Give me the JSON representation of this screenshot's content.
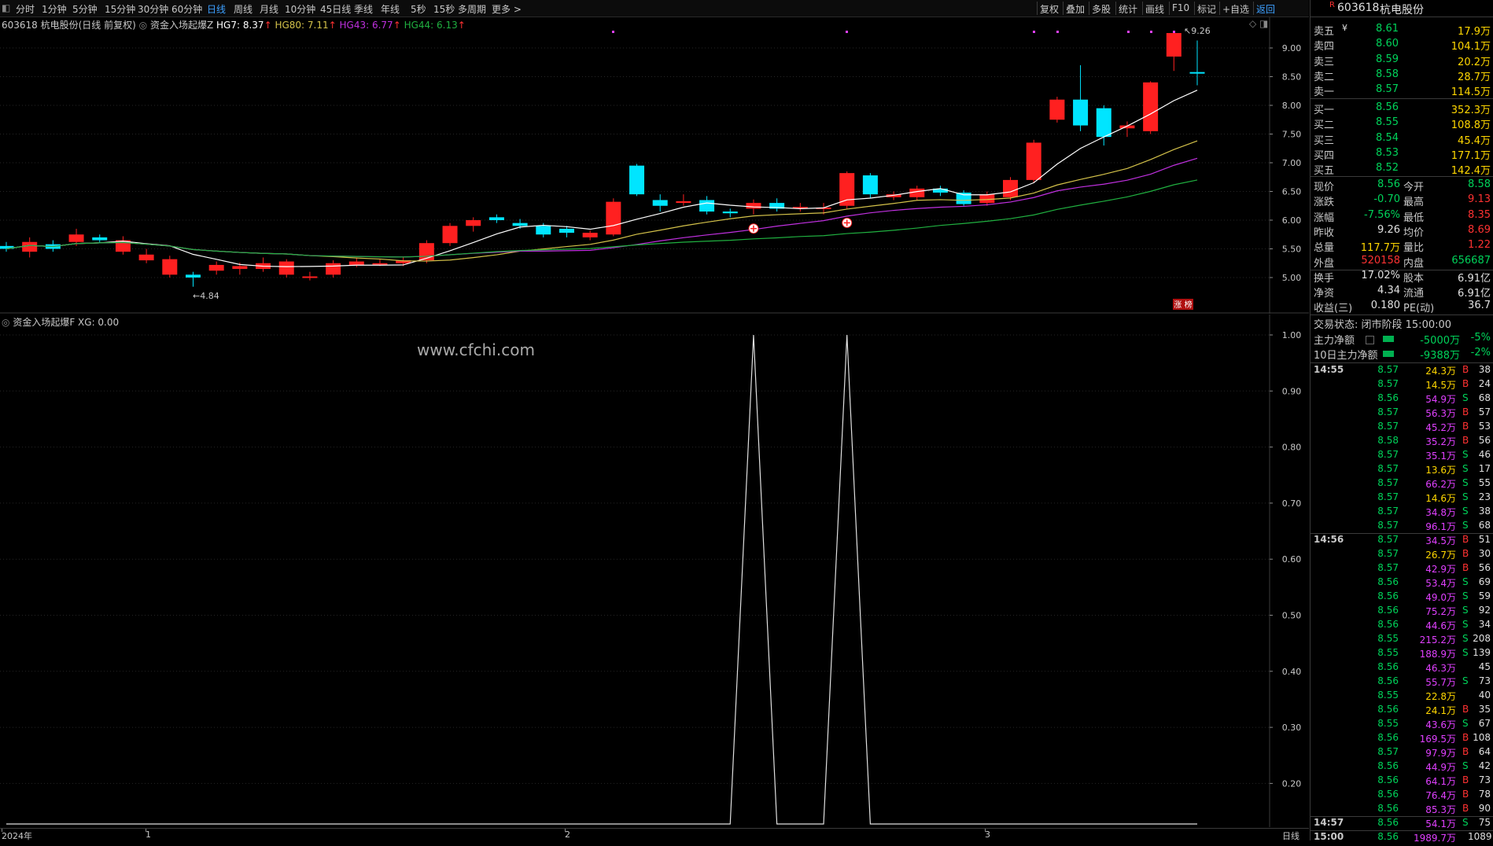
{
  "toolbar": {
    "periods": [
      "分时",
      "1分钟",
      "5分钟",
      "15分钟",
      "30分钟",
      "60分钟",
      "日线",
      "周线",
      "月线",
      "10分钟",
      "45日线",
      "季线",
      "年线",
      "5秒",
      "15秒",
      "多周期",
      "更多 >"
    ],
    "active_period": "日线",
    "right_buttons": [
      "复权",
      "叠加",
      "多股",
      "统计",
      "画线",
      "F10",
      "标记",
      "+自选",
      "返回"
    ]
  },
  "main_chart": {
    "stock_label": "603618 杭电股份(日线 前复权)",
    "indicator_name": "资金入场起爆Z",
    "hg7": "HG7: 8.37",
    "hg80": "HG80: 7.11",
    "hg43": "HG43: 6.77",
    "hg44": "HG44: 6.13",
    "y_ticks": [
      "9.00",
      "8.50",
      "8.00",
      "7.50",
      "7.00",
      "6.50",
      "6.00",
      "5.50",
      "5.00"
    ],
    "high_label": "9.26",
    "low_label": "4.84",
    "limit_badge": "涨 榜",
    "colors": {
      "up": "#ff2020",
      "down": "#00e5ff",
      "ma7": "#ffffff",
      "ma80": "#d4c24a",
      "ma43": "#c030e0",
      "ma44": "#20b040"
    }
  },
  "sub_chart": {
    "indicator_label": "资金入场起爆F",
    "xg": "XG: 0.00",
    "watermark": "www.cfchi.com",
    "y_ticks": [
      "1.00",
      "0.90",
      "0.80",
      "0.70",
      "0.60",
      "0.50",
      "0.40",
      "0.30",
      "0.20"
    ]
  },
  "x_axis": {
    "labels": [
      "2024年",
      "1",
      "2",
      "3"
    ],
    "period_label": "日线"
  },
  "panel": {
    "code": "603618",
    "name": "杭电股份",
    "sells": [
      {
        "label": "卖五",
        "price": "8.61",
        "vol": "17.9万"
      },
      {
        "label": "卖四",
        "price": "8.60",
        "vol": "104.1万"
      },
      {
        "label": "卖三",
        "price": "8.59",
        "vol": "20.2万"
      },
      {
        "label": "卖二",
        "price": "8.58",
        "vol": "28.7万"
      },
      {
        "label": "卖一",
        "price": "8.57",
        "vol": "114.5万"
      }
    ],
    "buys": [
      {
        "label": "买一",
        "price": "8.56",
        "vol": "352.3万"
      },
      {
        "label": "买二",
        "price": "8.55",
        "vol": "108.8万"
      },
      {
        "label": "买三",
        "price": "8.54",
        "vol": "45.4万"
      },
      {
        "label": "买四",
        "price": "8.53",
        "vol": "177.1万"
      },
      {
        "label": "买五",
        "price": "8.52",
        "vol": "142.4万"
      }
    ],
    "stats": [
      [
        "现价",
        "8.56",
        "今开",
        "8.58"
      ],
      [
        "涨跌",
        "-0.70",
        "最高",
        "9.13"
      ],
      [
        "涨幅",
        "-7.56%",
        "最低",
        "8.35"
      ],
      [
        "昨收",
        "9.26",
        "均价",
        "8.69"
      ],
      [
        "总量",
        "117.7万",
        "量比",
        "1.22"
      ],
      [
        "外盘",
        "520158",
        "内盘",
        "656687"
      ],
      [
        "换手",
        "17.02%",
        "股本",
        "6.91亿"
      ],
      [
        "净资",
        "4.34",
        "流通",
        "6.91亿"
      ],
      [
        "收益(三)",
        "0.180",
        "PE(动)",
        "36.7"
      ]
    ],
    "trade_status": "交易状态: 闭市阶段 15:00:00",
    "main_net_label": "主力净额",
    "main_net_value": "-5000万",
    "main_net_pct": "-5%",
    "main_net10_label": "10日主力净额",
    "main_net10_value": "-9388万",
    "main_net10_pct": "-2%",
    "ticks": [
      {
        "t": "14:55",
        "p": "8.57",
        "v": "24.3万",
        "s": "B",
        "n": "38"
      },
      {
        "t": "",
        "p": "8.57",
        "v": "14.5万",
        "s": "B",
        "n": "24"
      },
      {
        "t": "",
        "p": "8.56",
        "v": "54.9万",
        "s": "S",
        "n": "68"
      },
      {
        "t": "",
        "p": "8.57",
        "v": "56.3万",
        "s": "B",
        "n": "57"
      },
      {
        "t": "",
        "p": "8.57",
        "v": "45.2万",
        "s": "B",
        "n": "53"
      },
      {
        "t": "",
        "p": "8.58",
        "v": "35.2万",
        "s": "B",
        "n": "56"
      },
      {
        "t": "",
        "p": "8.57",
        "v": "35.1万",
        "s": "S",
        "n": "46"
      },
      {
        "t": "",
        "p": "8.57",
        "v": "13.6万",
        "s": "S",
        "n": "17"
      },
      {
        "t": "",
        "p": "8.57",
        "v": "66.2万",
        "s": "S",
        "n": "55"
      },
      {
        "t": "",
        "p": "8.57",
        "v": "14.6万",
        "s": "S",
        "n": "23"
      },
      {
        "t": "",
        "p": "8.57",
        "v": "34.8万",
        "s": "S",
        "n": "38"
      },
      {
        "t": "",
        "p": "8.57",
        "v": "96.1万",
        "s": "S",
        "n": "68"
      },
      {
        "t": "14:56",
        "p": "8.57",
        "v": "34.5万",
        "s": "B",
        "n": "51"
      },
      {
        "t": "",
        "p": "8.57",
        "v": "26.7万",
        "s": "B",
        "n": "30"
      },
      {
        "t": "",
        "p": "8.57",
        "v": "42.9万",
        "s": "B",
        "n": "56"
      },
      {
        "t": "",
        "p": "8.56",
        "v": "53.4万",
        "s": "S",
        "n": "69"
      },
      {
        "t": "",
        "p": "8.56",
        "v": "49.0万",
        "s": "S",
        "n": "59"
      },
      {
        "t": "",
        "p": "8.56",
        "v": "75.2万",
        "s": "S",
        "n": "92"
      },
      {
        "t": "",
        "p": "8.56",
        "v": "44.6万",
        "s": "S",
        "n": "34"
      },
      {
        "t": "",
        "p": "8.55",
        "v": "215.2万",
        "s": "S",
        "n": "208"
      },
      {
        "t": "",
        "p": "8.55",
        "v": "188.9万",
        "s": "S",
        "n": "139"
      },
      {
        "t": "",
        "p": "8.56",
        "v": "46.3万",
        "s": "",
        "n": "45"
      },
      {
        "t": "",
        "p": "8.56",
        "v": "55.7万",
        "s": "S",
        "n": "73"
      },
      {
        "t": "",
        "p": "8.55",
        "v": "22.8万",
        "s": "",
        "n": "40"
      },
      {
        "t": "",
        "p": "8.56",
        "v": "24.1万",
        "s": "B",
        "n": "35"
      },
      {
        "t": "",
        "p": "8.55",
        "v": "43.6万",
        "s": "S",
        "n": "67"
      },
      {
        "t": "",
        "p": "8.56",
        "v": "169.5万",
        "s": "B",
        "n": "108"
      },
      {
        "t": "",
        "p": "8.57",
        "v": "97.9万",
        "s": "B",
        "n": "64"
      },
      {
        "t": "",
        "p": "8.56",
        "v": "44.9万",
        "s": "S",
        "n": "42"
      },
      {
        "t": "",
        "p": "8.56",
        "v": "64.1万",
        "s": "B",
        "n": "73"
      },
      {
        "t": "",
        "p": "8.56",
        "v": "76.4万",
        "s": "B",
        "n": "78"
      },
      {
        "t": "",
        "p": "8.56",
        "v": "85.3万",
        "s": "B",
        "n": "90"
      },
      {
        "t": "14:57",
        "p": "8.56",
        "v": "54.1万",
        "s": "S",
        "n": "75"
      },
      {
        "t": "15:00",
        "p": "8.56",
        "v": "1989.7万",
        "s": "",
        "n": "1089"
      }
    ]
  },
  "chart_data": {
    "type": "candlestick",
    "ylim": [
      4.8,
      9.4
    ],
    "candles": [
      {
        "o": 5.55,
        "c": 5.5,
        "h": 5.62,
        "l": 5.45
      },
      {
        "o": 5.45,
        "c": 5.62,
        "h": 5.7,
        "l": 5.35
      },
      {
        "o": 5.58,
        "c": 5.5,
        "h": 5.65,
        "l": 5.45
      },
      {
        "o": 5.62,
        "c": 5.75,
        "h": 5.85,
        "l": 5.55
      },
      {
        "o": 5.7,
        "c": 5.65,
        "h": 5.75,
        "l": 5.6
      },
      {
        "o": 5.45,
        "c": 5.65,
        "h": 5.72,
        "l": 5.4
      },
      {
        "o": 5.3,
        "c": 5.4,
        "h": 5.5,
        "l": 5.25
      },
      {
        "o": 5.05,
        "c": 5.32,
        "h": 5.38,
        "l": 5.0
      },
      {
        "o": 5.05,
        "c": 5.0,
        "h": 5.1,
        "l": 4.84
      },
      {
        "o": 5.12,
        "c": 5.22,
        "h": 5.28,
        "l": 5.05
      },
      {
        "o": 5.15,
        "c": 5.2,
        "h": 5.26,
        "l": 5.05
      },
      {
        "o": 5.15,
        "c": 5.25,
        "h": 5.35,
        "l": 5.1
      },
      {
        "o": 5.05,
        "c": 5.28,
        "h": 5.32,
        "l": 5.0
      },
      {
        "o": 5.0,
        "c": 5.02,
        "h": 5.1,
        "l": 4.95
      },
      {
        "o": 5.05,
        "c": 5.25,
        "h": 5.3,
        "l": 5.0
      },
      {
        "o": 5.22,
        "c": 5.28,
        "h": 5.35,
        "l": 5.18
      },
      {
        "o": 5.25,
        "c": 5.25,
        "h": 5.32,
        "l": 5.2
      },
      {
        "o": 5.25,
        "c": 5.3,
        "h": 5.36,
        "l": 5.2
      },
      {
        "o": 5.3,
        "c": 5.6,
        "h": 5.65,
        "l": 5.25
      },
      {
        "o": 5.6,
        "c": 5.9,
        "h": 5.95,
        "l": 5.55
      },
      {
        "o": 5.9,
        "c": 6.0,
        "h": 6.05,
        "l": 5.8
      },
      {
        "o": 6.05,
        "c": 6.0,
        "h": 6.1,
        "l": 5.95
      },
      {
        "o": 5.95,
        "c": 5.9,
        "h": 6.02,
        "l": 5.85
      },
      {
        "o": 5.9,
        "c": 5.75,
        "h": 5.95,
        "l": 5.7
      },
      {
        "o": 5.85,
        "c": 5.78,
        "h": 5.9,
        "l": 5.7
      },
      {
        "o": 5.7,
        "c": 5.78,
        "h": 5.82,
        "l": 5.65
      },
      {
        "o": 5.75,
        "c": 6.32,
        "h": 6.38,
        "l": 5.72
      },
      {
        "o": 6.95,
        "c": 6.45,
        "h": 6.98,
        "l": 6.42
      },
      {
        "o": 6.35,
        "c": 6.25,
        "h": 6.45,
        "l": 6.15
      },
      {
        "o": 6.3,
        "c": 6.33,
        "h": 6.45,
        "l": 6.25
      },
      {
        "o": 6.35,
        "c": 6.15,
        "h": 6.42,
        "l": 6.1
      },
      {
        "o": 6.15,
        "c": 6.12,
        "h": 6.2,
        "l": 6.05
      },
      {
        "o": 6.2,
        "c": 6.3,
        "h": 6.36,
        "l": 6.1
      },
      {
        "o": 6.3,
        "c": 6.2,
        "h": 6.38,
        "l": 6.15
      },
      {
        "o": 6.2,
        "c": 6.23,
        "h": 6.3,
        "l": 6.15
      },
      {
        "o": 6.2,
        "c": 6.22,
        "h": 6.3,
        "l": 6.1
      },
      {
        "o": 6.25,
        "c": 6.82,
        "h": 6.85,
        "l": 6.2
      },
      {
        "o": 6.78,
        "c": 6.45,
        "h": 6.82,
        "l": 6.38
      },
      {
        "o": 6.4,
        "c": 6.45,
        "h": 6.5,
        "l": 6.35
      },
      {
        "o": 6.4,
        "c": 6.55,
        "h": 6.6,
        "l": 6.35
      },
      {
        "o": 6.55,
        "c": 6.48,
        "h": 6.6,
        "l": 6.42
      },
      {
        "o": 6.48,
        "c": 6.28,
        "h": 6.52,
        "l": 6.25
      },
      {
        "o": 6.3,
        "c": 6.45,
        "h": 6.5,
        "l": 6.25
      },
      {
        "o": 6.4,
        "c": 6.7,
        "h": 6.75,
        "l": 6.35
      },
      {
        "o": 6.7,
        "c": 7.35,
        "h": 7.4,
        "l": 6.65
      },
      {
        "o": 7.75,
        "c": 8.1,
        "h": 8.15,
        "l": 7.7
      },
      {
        "o": 8.1,
        "c": 7.65,
        "h": 8.7,
        "l": 7.55
      },
      {
        "o": 7.95,
        "c": 7.45,
        "h": 8.0,
        "l": 7.3
      },
      {
        "o": 7.6,
        "c": 7.65,
        "h": 7.72,
        "l": 7.45
      },
      {
        "o": 7.55,
        "c": 8.4,
        "h": 8.42,
        "l": 7.5
      },
      {
        "o": 8.85,
        "c": 9.26,
        "h": 9.3,
        "l": 8.6
      },
      {
        "o": 8.58,
        "c": 8.56,
        "h": 9.13,
        "l": 8.35
      }
    ],
    "sub_series": {
      "xg_spikes_at_candle": [
        32,
        36
      ]
    },
    "xlabels": [
      "2024年",
      "1",
      "2",
      "3"
    ]
  }
}
